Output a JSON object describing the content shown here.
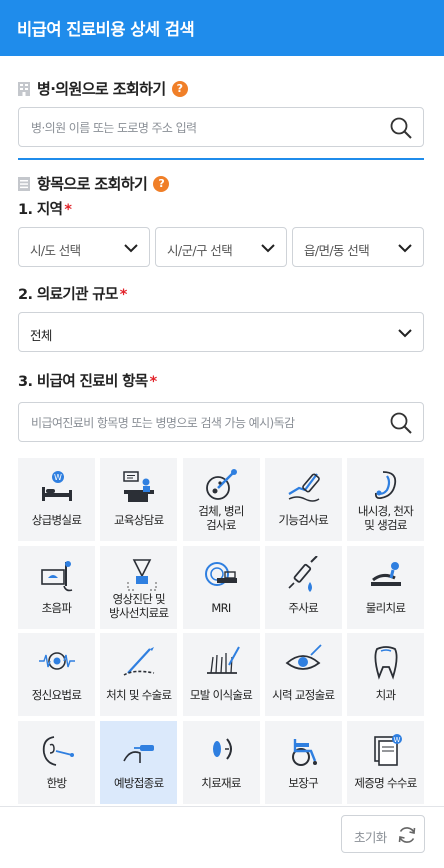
{
  "header": {
    "title": "비급여 진료비용 상세 검색"
  },
  "hospital_search": {
    "title": "병·의원으로 조회하기",
    "help": "?",
    "placeholder": "병·의원 이름 또는 도로명 주소 입력"
  },
  "item_search": {
    "title": "항목으로 조회하기",
    "help": "?",
    "region": {
      "label": "1. 지역",
      "required_mark": "*",
      "sido": "시/도 선택",
      "sigungu": "시/군/구 선택",
      "eupmyeondong": "읍/면/동 선택"
    },
    "scale": {
      "label": "2. 의료기관 규모",
      "required_mark": "*",
      "value": "전체"
    },
    "item": {
      "label": "3. 비급여 진료비 항목",
      "required_mark": "*",
      "placeholder": "비급여진료비 항목명 또는 병명으로 검색 가능 예시)독감"
    },
    "categories": [
      {
        "label": "상급병실료",
        "icon": "hospital-bed-icon"
      },
      {
        "label": "교육상담료",
        "icon": "consultation-icon"
      },
      {
        "label": "검체, 병리\n검사료",
        "icon": "specimen-icon"
      },
      {
        "label": "기능검사료",
        "icon": "function-test-icon"
      },
      {
        "label": "내시경, 천자\n및 생검료",
        "icon": "endoscope-icon"
      },
      {
        "label": "초음파",
        "icon": "ultrasound-icon"
      },
      {
        "label": "영상진단 및\n방사선치료료",
        "icon": "radiology-icon"
      },
      {
        "label": "MRI",
        "icon": "mri-icon"
      },
      {
        "label": "주사료",
        "icon": "injection-icon"
      },
      {
        "label": "물리치료",
        "icon": "physiotherapy-icon"
      },
      {
        "label": "정신요법료",
        "icon": "brain-wave-icon"
      },
      {
        "label": "처치 및 수술료",
        "icon": "surgery-icon"
      },
      {
        "label": "모발 이식술료",
        "icon": "hair-transplant-icon"
      },
      {
        "label": "시력 교정술료",
        "icon": "eye-icon"
      },
      {
        "label": "치과",
        "icon": "tooth-icon"
      },
      {
        "label": "한방",
        "icon": "acupuncture-icon"
      },
      {
        "label": "예방접종료",
        "icon": "vaccination-icon",
        "selected": true
      },
      {
        "label": "치료재료",
        "icon": "lens-icon"
      },
      {
        "label": "보장구",
        "icon": "wheelchair-icon"
      },
      {
        "label": "제증명 수수료",
        "icon": "certificate-icon"
      }
    ]
  },
  "footer": {
    "reset": "초기화"
  },
  "colors": {
    "primary": "#1f8ceb",
    "accent": "#f07f28",
    "required": "#e2232a",
    "tile": "#f3f4f6",
    "tile_selected": "#dbe9fb"
  }
}
